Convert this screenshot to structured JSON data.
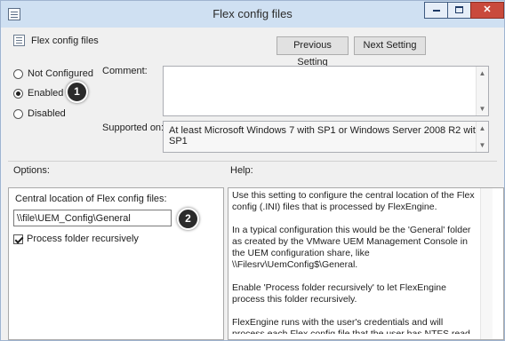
{
  "window": {
    "title": "Flex config files"
  },
  "setting": {
    "name": "Flex config files"
  },
  "nav": {
    "previous_label": "Previous Setting",
    "next_label": "Next Setting"
  },
  "state": {
    "not_configured_label": "Not Configured",
    "enabled_label": "Enabled",
    "disabled_label": "Disabled",
    "selected": "Enabled"
  },
  "comment": {
    "label": "Comment:",
    "value": ""
  },
  "supported": {
    "label": "Supported on:",
    "value": "At least Microsoft Windows 7 with SP1 or Windows Server 2008 R2 with SP1"
  },
  "options": {
    "label": "Options:",
    "central_location_label": "Central location of Flex config files:",
    "central_location_value": "\\\\file\\UEM_Config\\General",
    "process_recursively_label": "Process folder recursively",
    "process_recursively_checked": true
  },
  "help": {
    "label": "Help:",
    "paragraphs": [
      "Use this setting to configure the central location of the Flex config (.INI) files that is processed by FlexEngine.",
      "In a typical configuration this would be the 'General' folder as created by the VMware UEM Management Console in the UEM configuration share, like \\\\Filesrv\\UemConfig$\\General.",
      "Enable 'Process folder recursively' to let FlexEngine process this folder recursively.",
      "FlexEngine runs with the user's credentials and will process each Flex config file that the user has NTFS read access to."
    ]
  },
  "annotations": {
    "badge_1": "1",
    "badge_2": "2"
  }
}
